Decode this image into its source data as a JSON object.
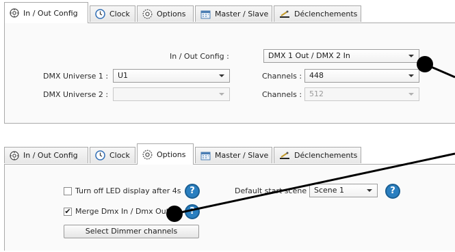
{
  "tabs": {
    "inout": "In / Out Config",
    "clock": "Clock",
    "options": "Options",
    "master": "Master / Slave",
    "decl": "Déclenchements"
  },
  "inout_panel": {
    "config_label": "In / Out Config :",
    "config_value": "DMX 1 Out / DMX 2 In",
    "universe1_label": "DMX Universe 1 :",
    "universe1_value": "U1",
    "universe2_label": "DMX Universe 2 :",
    "universe2_value": "",
    "channels1_label": "Channels :",
    "channels1_value": "448",
    "channels2_label": "Channels :",
    "channels2_value": "512"
  },
  "options_panel": {
    "led_label": "Turn off LED display after 4s",
    "led_checked": false,
    "merge_label": "Merge Dmx In / Dmx Out",
    "merge_checked": true,
    "merge_check_glyph": "✔",
    "scene_label": "Default start scene :",
    "scene_value": "Scene 1",
    "dimmer_button": "Select Dimmer channels",
    "help_glyph": "?"
  },
  "icons": {
    "inout": "gear-network-icon",
    "clock": "clock-icon",
    "options": "gear-icon",
    "master": "calendar-icon",
    "decl": "trigger-icon"
  }
}
